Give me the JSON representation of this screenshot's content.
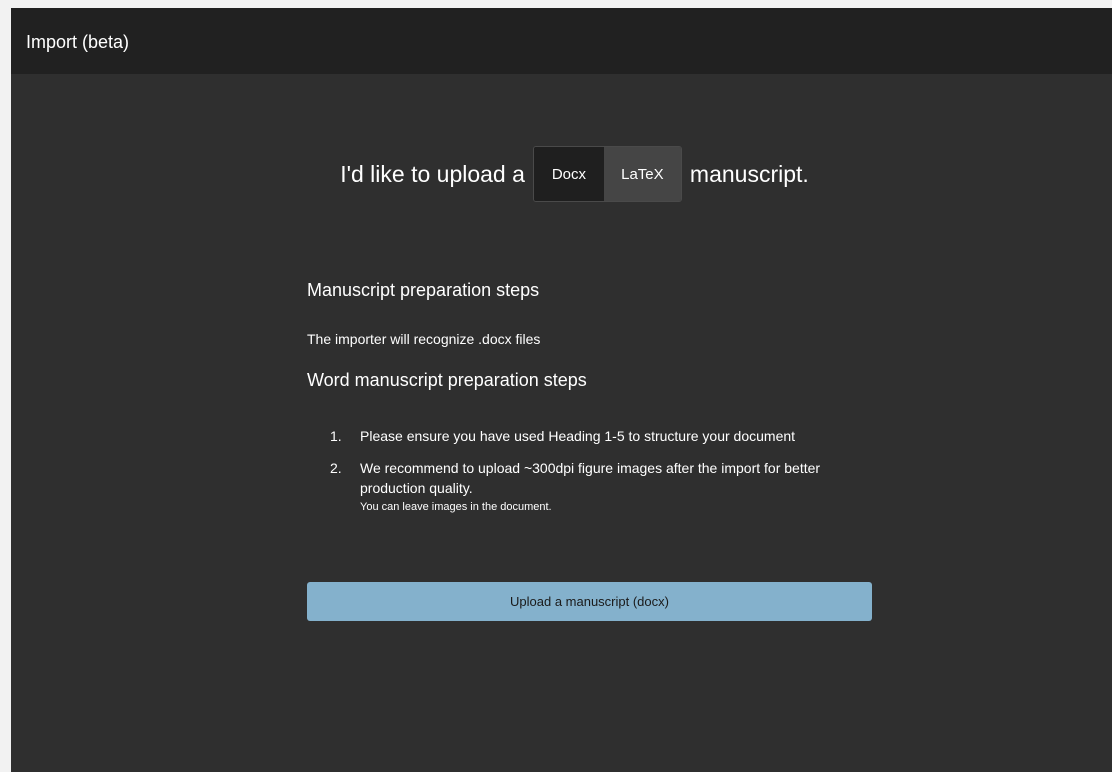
{
  "window": {
    "title": "Import (beta)"
  },
  "upload_selector": {
    "prefix": "I'd like to upload a",
    "options": [
      "Docx",
      "LaTeX"
    ],
    "selected": "Docx",
    "suffix": "manuscript."
  },
  "instructions": {
    "heading": "Manuscript preparation steps",
    "recognize_text": "The importer will recognize .docx files",
    "word_heading": "Word manuscript preparation steps",
    "steps": [
      {
        "number": "1.",
        "text": "Please ensure you have used Heading 1-5 to structure your document",
        "note": ""
      },
      {
        "number": "2.",
        "text": "We recommend to upload ~300dpi figure images after the import for better production quality.",
        "note": "You can leave images in the document."
      }
    ]
  },
  "upload_button": {
    "label": "Upload a manuscript (docx)"
  },
  "colors": {
    "background": "#2f2f2f",
    "titlebar": "#212121",
    "button": "#84b1cc",
    "toggle_active": "#1f1f1f",
    "toggle_inactive": "#454545"
  }
}
